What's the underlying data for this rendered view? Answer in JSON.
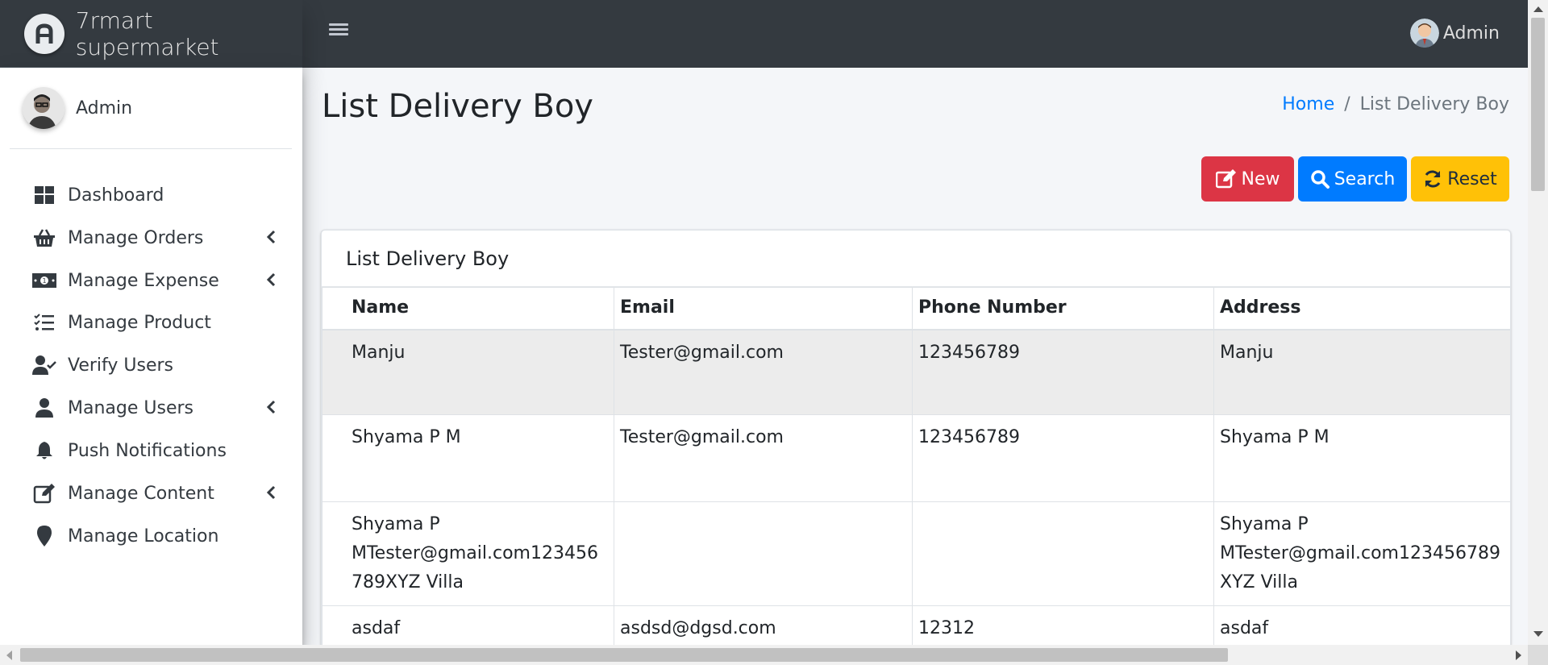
{
  "brand": {
    "name": "7rmart supermarket"
  },
  "topbar": {
    "user_name": "Admin"
  },
  "sidebar": {
    "user_name": "Admin",
    "items": [
      {
        "label": "Dashboard",
        "icon": "dashboard-icon",
        "has_submenu": false
      },
      {
        "label": "Manage Orders",
        "icon": "basket-icon",
        "has_submenu": true
      },
      {
        "label": "Manage Expense",
        "icon": "money-icon",
        "has_submenu": true
      },
      {
        "label": "Manage Product",
        "icon": "tasks-icon",
        "has_submenu": false
      },
      {
        "label": "Verify Users",
        "icon": "user-check-icon",
        "has_submenu": false
      },
      {
        "label": "Manage Users",
        "icon": "user-icon",
        "has_submenu": true
      },
      {
        "label": "Push Notifications",
        "icon": "bell-icon",
        "has_submenu": false
      },
      {
        "label": "Manage Content",
        "icon": "edit-icon",
        "has_submenu": true
      },
      {
        "label": "Manage Location",
        "icon": "map-marker-icon",
        "has_submenu": false
      }
    ]
  },
  "page": {
    "title": "List Delivery Boy"
  },
  "breadcrumb": {
    "home": "Home",
    "separator": "/",
    "current": "List Delivery Boy"
  },
  "actions": {
    "new_label": "New",
    "search_label": "Search",
    "reset_label": "Reset"
  },
  "card": {
    "title": "List Delivery Boy"
  },
  "table": {
    "headers": [
      "Name",
      "Email",
      "Phone Number",
      "Address"
    ],
    "rows": [
      [
        "Manju",
        "Tester@gmail.com",
        "123456789",
        "Manju"
      ],
      [
        "Shyama P M",
        "Tester@gmail.com",
        "123456789",
        "Shyama P M"
      ],
      [
        "Shyama P MTester@gmail.com123456789XYZ Villa",
        "",
        "",
        "Shyama P MTester@gmail.com123456789XYZ Villa"
      ],
      [
        "asdaf",
        "asdsd@dgsd.com",
        "12312",
        "asdaf"
      ]
    ]
  },
  "colors": {
    "topbar": "#343a40",
    "danger": "#dc3545",
    "primary": "#007bff",
    "warning": "#ffc107",
    "link": "#007bff"
  }
}
